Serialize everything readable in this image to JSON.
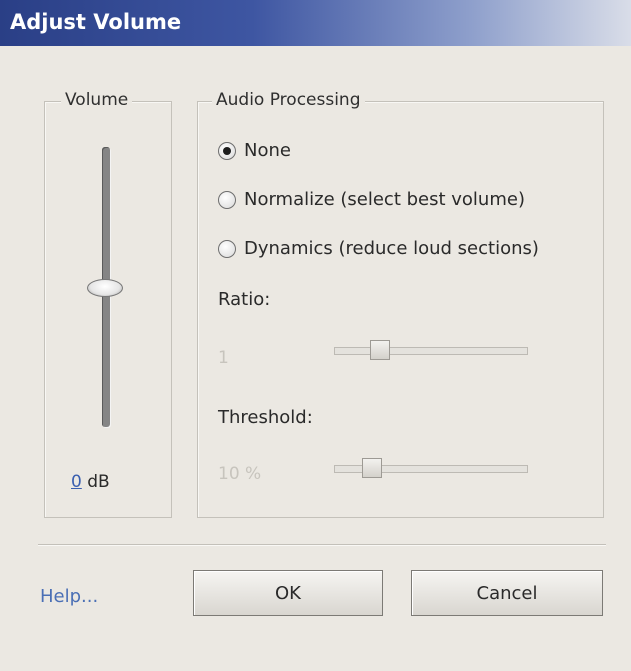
{
  "window": {
    "title": "Adjust Volume"
  },
  "volume": {
    "legend": "Volume",
    "value": "0",
    "unit": "dB",
    "slider_level_db": 0
  },
  "audio_processing": {
    "legend": "Audio Processing",
    "options": [
      {
        "label": "None",
        "checked": true
      },
      {
        "label": "Normalize (select best volume)",
        "checked": false
      },
      {
        "label": "Dynamics (reduce loud sections)",
        "checked": false
      }
    ],
    "ratio": {
      "label": "Ratio:",
      "value": "1"
    },
    "threshold": {
      "label": "Threshold:",
      "value": "10 %"
    }
  },
  "footer": {
    "help": "Help...",
    "ok": "OK",
    "cancel": "Cancel"
  }
}
